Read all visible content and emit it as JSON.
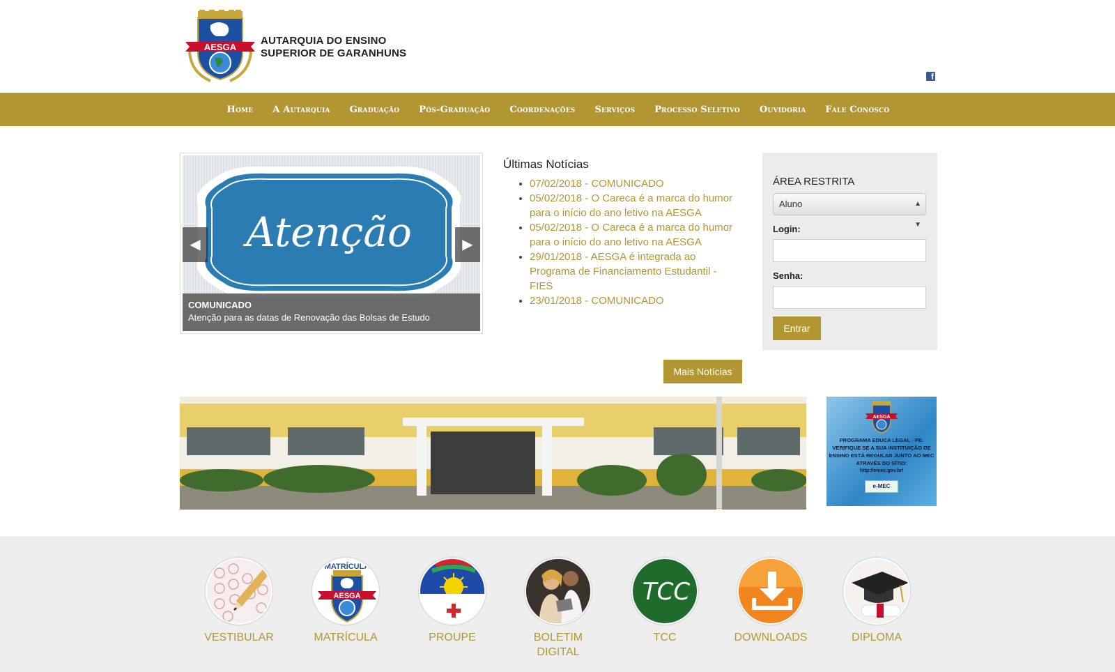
{
  "header": {
    "logo_acronym": "AESGA",
    "org_line1": "AUTARQUIA DO ENSINO",
    "org_line2": "SUPERIOR DE GARANHUNS"
  },
  "nav": [
    "Home",
    "A Autarquia",
    "Graduação",
    "Pós-Graduação",
    "Coordenações",
    "Serviços",
    "Processo Seletivo",
    "Ouvidoria",
    "Fale Conosco"
  ],
  "slider": {
    "image_text": "Atenção",
    "caption_title": "COMUNICADO",
    "caption_text": "Atenção para as datas de Renovação das Bolsas de Estudo"
  },
  "news": {
    "heading": "Últimas Notícias",
    "items": [
      "07/02/2018 - COMUNICADO",
      "05/02/2018 - O Careca é a marca do humor para o início do ano letivo na AESGA",
      "05/02/2018 - O Careca é a marca do humor para o início do ano letivo na AESGA",
      "29/01/2018 - AESGA é integrada ao Programa de Financiamento Estudantil - FIES",
      "23/01/2018 - COMUNICADO"
    ],
    "more_button": "Mais Notícias"
  },
  "restricted": {
    "heading": "ÁREA RESTRITA",
    "select_value": "Aluno",
    "login_label": "Login:",
    "password_label": "Senha:",
    "submit": "Entrar"
  },
  "emec_banner": {
    "acronym": "AESGA",
    "text": "PROGRAMA EDUCA LEGAL - PE: VERIFIQUE SE A SUA INSTITUIÇÃO DE ENSINO ESTÁ REGULAR JUNTO AO MEC ATRAVÉS DO SÍTIO:",
    "url": "http://emec.gov.br/",
    "logo": "e-MEC"
  },
  "quick_links": [
    {
      "label": "VESTIBULAR",
      "icon": "exam-pencil-icon"
    },
    {
      "label": "MATRÍCULA",
      "icon": "matricula-crest-icon"
    },
    {
      "label": "PROUPE",
      "icon": "pernambuco-flag-icon"
    },
    {
      "label": "BOLETIM DIGITAL",
      "icon": "students-icon"
    },
    {
      "label": "TCC",
      "icon": "tcc-icon"
    },
    {
      "label": "DOWNLOADS",
      "icon": "download-icon"
    },
    {
      "label": "DIPLOMA",
      "icon": "graduation-cap-icon"
    }
  ],
  "matricula_arc": "MATRÍCULA",
  "tcc_text": "TCC",
  "colors": {
    "brand_gold": "#b19632",
    "footer_bg": "#eeeeee",
    "panel_bg": "#ececec"
  }
}
